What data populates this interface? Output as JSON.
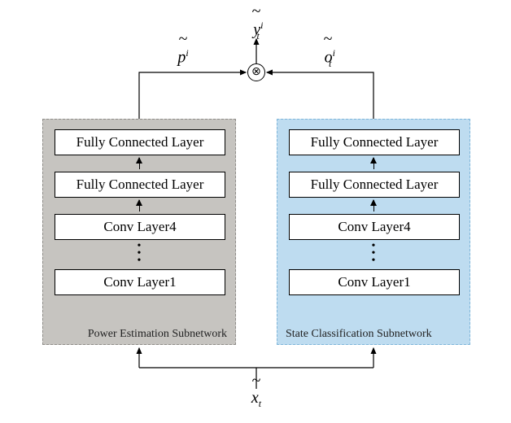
{
  "output_label": "ỹ_t^i",
  "p_label": "p̃^i",
  "o_label": "õ_t^i",
  "input_label": "x̃_t",
  "multiply_symbol": "×",
  "left": {
    "caption": "Power Estimation Subnetwork",
    "layers": {
      "fc2": "Fully Connected Layer",
      "fc1": "Fully Connected Layer",
      "conv4": "Conv Layer4",
      "conv1": "Conv Layer1"
    }
  },
  "right": {
    "caption": "State Classification Subnetwork",
    "layers": {
      "fc2": "Fully Connected Layer",
      "fc1": "Fully Connected Layer",
      "conv4": "Conv Layer4",
      "conv1": "Conv Layer1"
    }
  },
  "y_var": "y",
  "y_sub": "t",
  "y_sup": "i",
  "p_var": "p",
  "p_sup": "i",
  "o_var": "o",
  "o_sub": "t",
  "o_sup": "i",
  "x_var": "x",
  "x_sub": "t"
}
